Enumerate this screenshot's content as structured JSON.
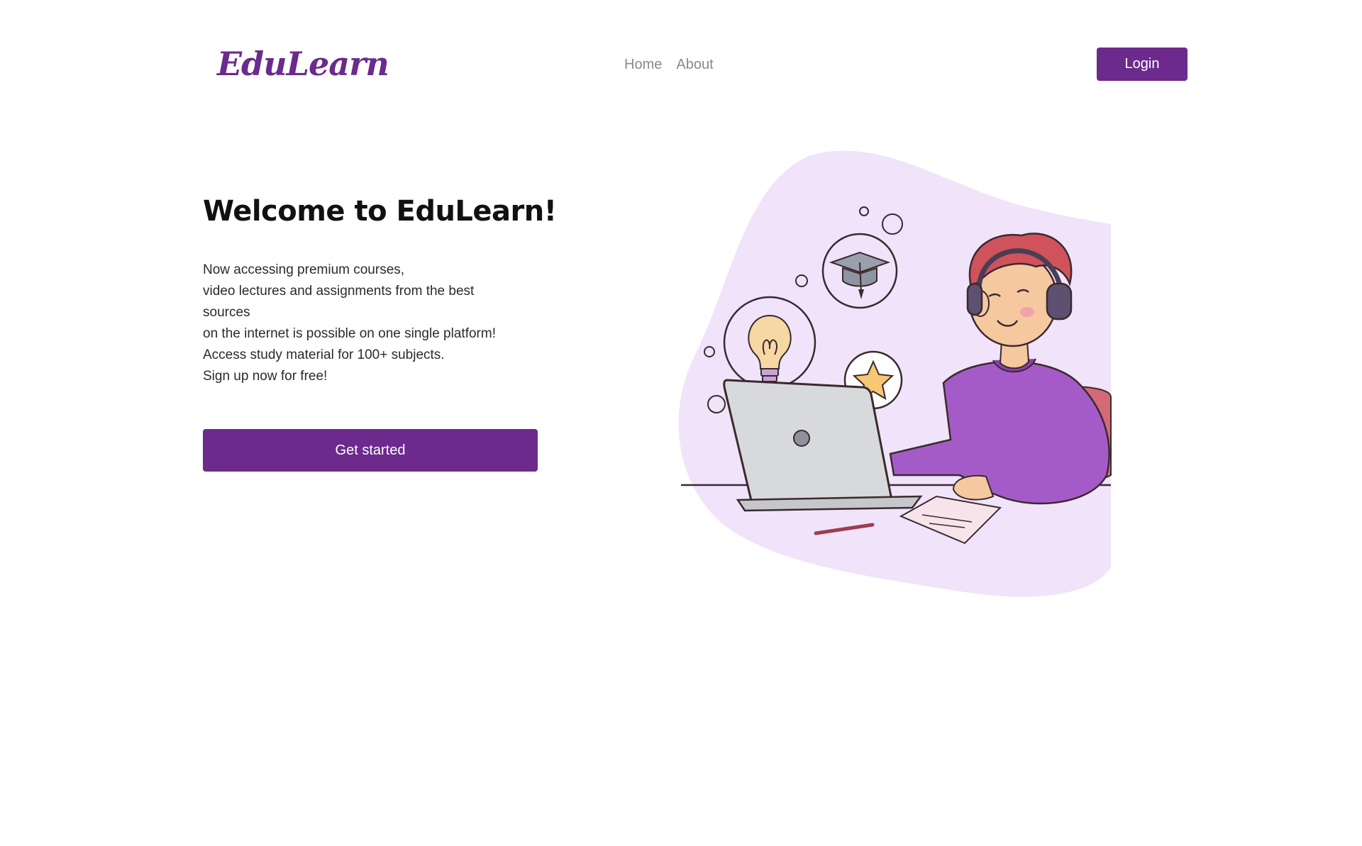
{
  "header": {
    "brand": "EduLearn",
    "nav": [
      {
        "label": "Home"
      },
      {
        "label": "About"
      }
    ],
    "login_label": "Login"
  },
  "hero": {
    "title": "Welcome to EduLearn!",
    "description_lines": [
      "Now accessing premium courses,",
      "video lectures and assignments from the best",
      "sources",
      "on the internet is possible on one single platform!",
      "Access study material for 100+ subjects.",
      "Sign up now for free!"
    ],
    "cta_label": "Get started"
  },
  "colors": {
    "brand_purple": "#6b2a8c",
    "blob_lavender": "#f1e3fa",
    "sweater_purple": "#a55bc7",
    "hair_red": "#d0525b"
  },
  "icons": [
    "graduation-cap-icon",
    "lightbulb-icon",
    "star-icon"
  ]
}
